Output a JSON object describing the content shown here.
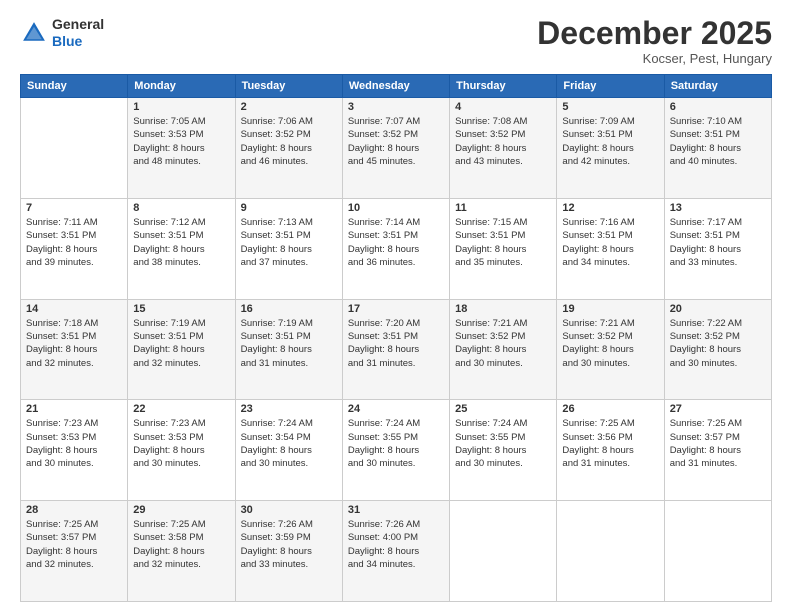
{
  "header": {
    "logo": {
      "general": "General",
      "blue": "Blue"
    },
    "title": "December 2025",
    "location": "Kocser, Pest, Hungary"
  },
  "calendar": {
    "days_of_week": [
      "Sunday",
      "Monday",
      "Tuesday",
      "Wednesday",
      "Thursday",
      "Friday",
      "Saturday"
    ],
    "weeks": [
      [
        {
          "day": "",
          "info": ""
        },
        {
          "day": "1",
          "info": "Sunrise: 7:05 AM\nSunset: 3:53 PM\nDaylight: 8 hours\nand 48 minutes."
        },
        {
          "day": "2",
          "info": "Sunrise: 7:06 AM\nSunset: 3:52 PM\nDaylight: 8 hours\nand 46 minutes."
        },
        {
          "day": "3",
          "info": "Sunrise: 7:07 AM\nSunset: 3:52 PM\nDaylight: 8 hours\nand 45 minutes."
        },
        {
          "day": "4",
          "info": "Sunrise: 7:08 AM\nSunset: 3:52 PM\nDaylight: 8 hours\nand 43 minutes."
        },
        {
          "day": "5",
          "info": "Sunrise: 7:09 AM\nSunset: 3:51 PM\nDaylight: 8 hours\nand 42 minutes."
        },
        {
          "day": "6",
          "info": "Sunrise: 7:10 AM\nSunset: 3:51 PM\nDaylight: 8 hours\nand 40 minutes."
        }
      ],
      [
        {
          "day": "7",
          "info": "Sunrise: 7:11 AM\nSunset: 3:51 PM\nDaylight: 8 hours\nand 39 minutes."
        },
        {
          "day": "8",
          "info": "Sunrise: 7:12 AM\nSunset: 3:51 PM\nDaylight: 8 hours\nand 38 minutes."
        },
        {
          "day": "9",
          "info": "Sunrise: 7:13 AM\nSunset: 3:51 PM\nDaylight: 8 hours\nand 37 minutes."
        },
        {
          "day": "10",
          "info": "Sunrise: 7:14 AM\nSunset: 3:51 PM\nDaylight: 8 hours\nand 36 minutes."
        },
        {
          "day": "11",
          "info": "Sunrise: 7:15 AM\nSunset: 3:51 PM\nDaylight: 8 hours\nand 35 minutes."
        },
        {
          "day": "12",
          "info": "Sunrise: 7:16 AM\nSunset: 3:51 PM\nDaylight: 8 hours\nand 34 minutes."
        },
        {
          "day": "13",
          "info": "Sunrise: 7:17 AM\nSunset: 3:51 PM\nDaylight: 8 hours\nand 33 minutes."
        }
      ],
      [
        {
          "day": "14",
          "info": "Sunrise: 7:18 AM\nSunset: 3:51 PM\nDaylight: 8 hours\nand 32 minutes."
        },
        {
          "day": "15",
          "info": "Sunrise: 7:19 AM\nSunset: 3:51 PM\nDaylight: 8 hours\nand 32 minutes."
        },
        {
          "day": "16",
          "info": "Sunrise: 7:19 AM\nSunset: 3:51 PM\nDaylight: 8 hours\nand 31 minutes."
        },
        {
          "day": "17",
          "info": "Sunrise: 7:20 AM\nSunset: 3:51 PM\nDaylight: 8 hours\nand 31 minutes."
        },
        {
          "day": "18",
          "info": "Sunrise: 7:21 AM\nSunset: 3:52 PM\nDaylight: 8 hours\nand 30 minutes."
        },
        {
          "day": "19",
          "info": "Sunrise: 7:21 AM\nSunset: 3:52 PM\nDaylight: 8 hours\nand 30 minutes."
        },
        {
          "day": "20",
          "info": "Sunrise: 7:22 AM\nSunset: 3:52 PM\nDaylight: 8 hours\nand 30 minutes."
        }
      ],
      [
        {
          "day": "21",
          "info": "Sunrise: 7:23 AM\nSunset: 3:53 PM\nDaylight: 8 hours\nand 30 minutes."
        },
        {
          "day": "22",
          "info": "Sunrise: 7:23 AM\nSunset: 3:53 PM\nDaylight: 8 hours\nand 30 minutes."
        },
        {
          "day": "23",
          "info": "Sunrise: 7:24 AM\nSunset: 3:54 PM\nDaylight: 8 hours\nand 30 minutes."
        },
        {
          "day": "24",
          "info": "Sunrise: 7:24 AM\nSunset: 3:55 PM\nDaylight: 8 hours\nand 30 minutes."
        },
        {
          "day": "25",
          "info": "Sunrise: 7:24 AM\nSunset: 3:55 PM\nDaylight: 8 hours\nand 30 minutes."
        },
        {
          "day": "26",
          "info": "Sunrise: 7:25 AM\nSunset: 3:56 PM\nDaylight: 8 hours\nand 31 minutes."
        },
        {
          "day": "27",
          "info": "Sunrise: 7:25 AM\nSunset: 3:57 PM\nDaylight: 8 hours\nand 31 minutes."
        }
      ],
      [
        {
          "day": "28",
          "info": "Sunrise: 7:25 AM\nSunset: 3:57 PM\nDaylight: 8 hours\nand 32 minutes."
        },
        {
          "day": "29",
          "info": "Sunrise: 7:25 AM\nSunset: 3:58 PM\nDaylight: 8 hours\nand 32 minutes."
        },
        {
          "day": "30",
          "info": "Sunrise: 7:26 AM\nSunset: 3:59 PM\nDaylight: 8 hours\nand 33 minutes."
        },
        {
          "day": "31",
          "info": "Sunrise: 7:26 AM\nSunset: 4:00 PM\nDaylight: 8 hours\nand 34 minutes."
        },
        {
          "day": "",
          "info": ""
        },
        {
          "day": "",
          "info": ""
        },
        {
          "day": "",
          "info": ""
        }
      ]
    ]
  }
}
